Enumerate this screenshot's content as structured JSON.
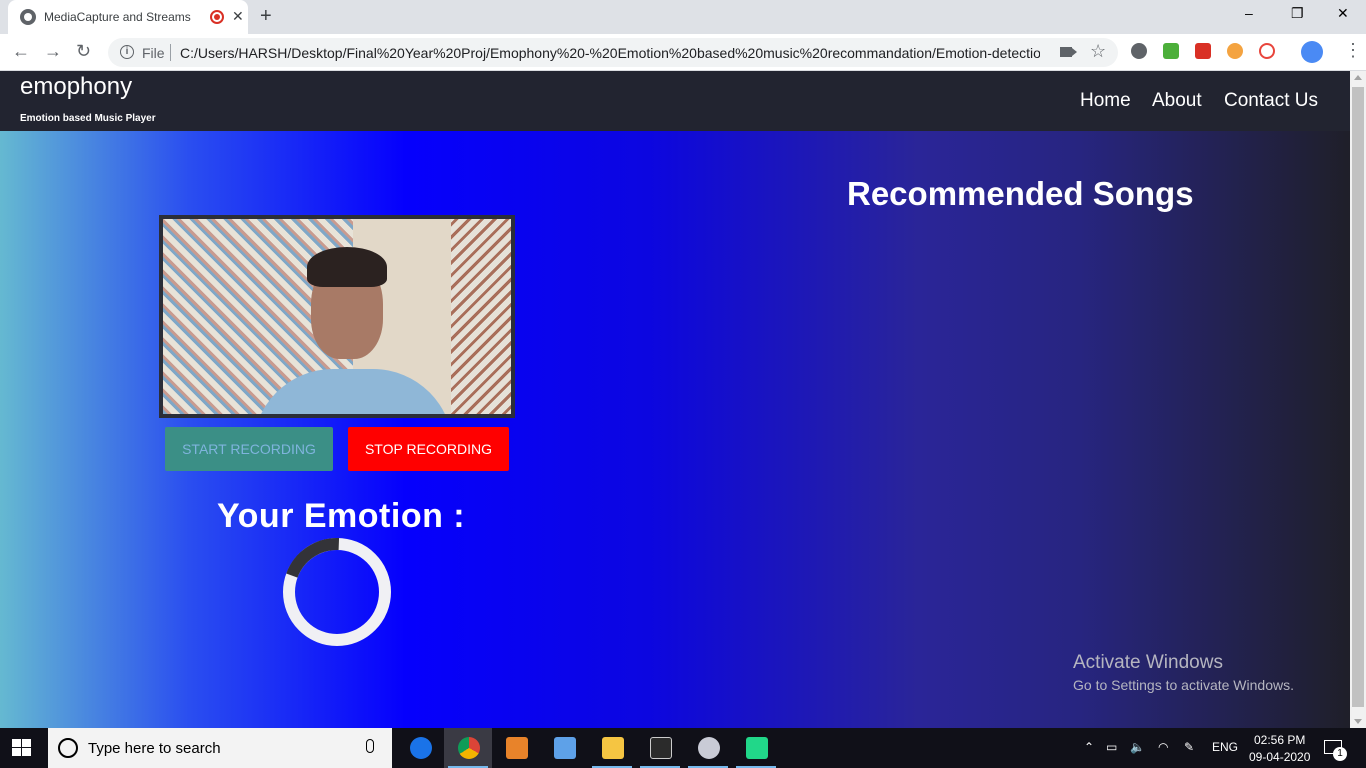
{
  "browser": {
    "tab_title": "MediaCapture and Streams /",
    "new_tab": "+",
    "close_tab": "✕",
    "file_label": "File",
    "url": "C:/Users/HARSH/Desktop/Final%20Year%20Proj/Emophony%20-%20Emotion%20based%20music%20recommandation/Emotion-detectio...",
    "window_controls": {
      "minimize": "–",
      "maximize": "❐",
      "close": "✕"
    }
  },
  "navbar": {
    "brand": "emophony",
    "tagline": "Emotion based Music Player",
    "links": [
      "Home",
      "About",
      "Contact Us"
    ]
  },
  "main": {
    "start_button": "START RECORDING",
    "stop_button": "STOP RECORDING",
    "emotion_label": "Your Emotion :",
    "recommended_heading": "Recommended Songs",
    "spinner_fraction": 0.2
  },
  "watermark": {
    "title": "Activate Windows",
    "subtitle": "Go to Settings to activate Windows."
  },
  "taskbar": {
    "search_placeholder": "Type here to search",
    "tray_lang": "ENG",
    "time": "02:56 PM",
    "date": "09-04-2020",
    "notification_count": "1"
  },
  "colors": {
    "navbar_bg": "#222430",
    "stop_button": "#ff0000",
    "start_button": "#3b8f86",
    "accent_blue": "#0500fd"
  }
}
